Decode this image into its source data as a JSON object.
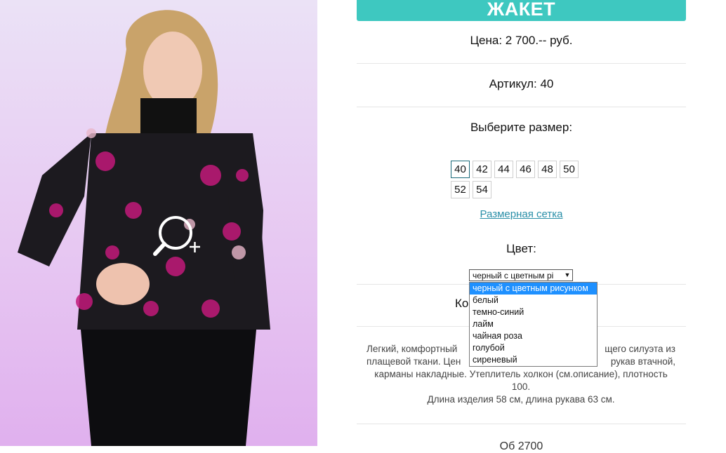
{
  "product": {
    "title": "ЖАКЕТ",
    "price": "Цена: 2 700.-- руб.",
    "article": "Артикул: 40",
    "size_prompt": "Выберите размер:",
    "sizes": [
      "40",
      "42",
      "44",
      "46",
      "48",
      "50",
      "52",
      "54"
    ],
    "selected_size": "40",
    "size_chart_link": "Размерная сетка",
    "color_label": "Цвет:",
    "color_select_value": "черный с цветным рі",
    "color_options": [
      "черный с цветным рисунком",
      "белый",
      "темно-синий",
      "лайм",
      "чайная роза",
      "голубой",
      "сиреневый"
    ],
    "quantity_label": "Ко",
    "description_lines": [
      "Легкий, комфортный",
      "щего силуэта из",
      "плащевой ткани. Цен",
      "рукав втачной,",
      "карманы накладные. Утеплитель холкон (см.описание), плотность 100.",
      "Длина изделия 58 см, длина рукава 63 см."
    ],
    "bottom_partial": "Об           2700"
  },
  "colors": {
    "accent": "#3ec8c0",
    "link": "#2a8fa8",
    "dropdown_highlight": "#1e90ff"
  },
  "icons": {
    "zoom": "magnifier-plus-icon"
  }
}
